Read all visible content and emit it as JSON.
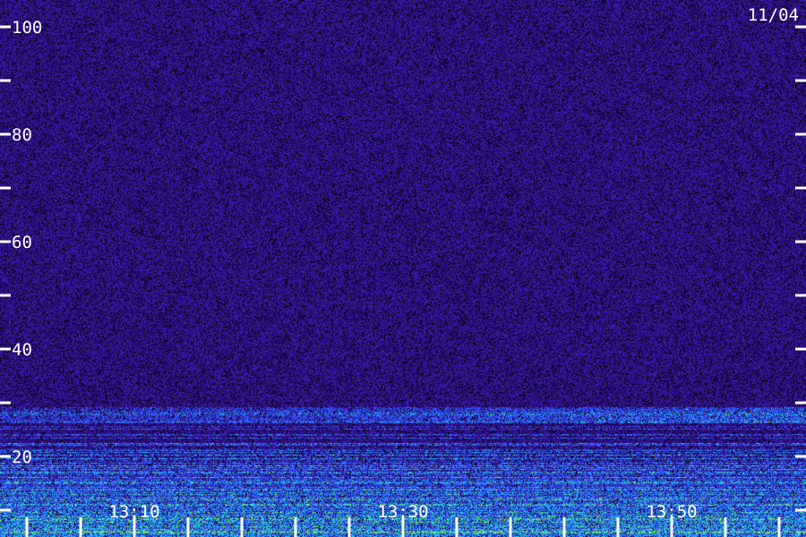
{
  "date_label": "11/04",
  "colors": {
    "background": "#000000",
    "noise_low": "#2a0a6e",
    "noise_mid": "#3a1bb0",
    "band_blue": "#2f5cff",
    "band_cyan": "#22c8e8",
    "band_green": "#8cff3a",
    "ticks": "#ffffff"
  },
  "chart_data": {
    "type": "heatmap",
    "title": "",
    "xlabel": "",
    "ylabel": "",
    "ylim": [
      0,
      100
    ],
    "xlim": [
      "13:00",
      "14:00"
    ],
    "y_ticks": [
      {
        "value": 100,
        "label": "100"
      },
      {
        "value": 90,
        "label": ""
      },
      {
        "value": 80,
        "label": "80"
      },
      {
        "value": 70,
        "label": ""
      },
      {
        "value": 60,
        "label": "60"
      },
      {
        "value": 50,
        "label": ""
      },
      {
        "value": 40,
        "label": "40"
      },
      {
        "value": 30,
        "label": ""
      },
      {
        "value": 20,
        "label": "20"
      },
      {
        "value": 10,
        "label": ""
      }
    ],
    "x_ticks": [
      {
        "value": "13:02",
        "label": ""
      },
      {
        "value": "13:06",
        "label": ""
      },
      {
        "value": "13:10",
        "label": "13:10"
      },
      {
        "value": "13:14",
        "label": ""
      },
      {
        "value": "13:18",
        "label": ""
      },
      {
        "value": "13:22",
        "label": ""
      },
      {
        "value": "13:26",
        "label": ""
      },
      {
        "value": "13:30",
        "label": "13:30"
      },
      {
        "value": "13:34",
        "label": ""
      },
      {
        "value": "13:38",
        "label": ""
      },
      {
        "value": "13:42",
        "label": ""
      },
      {
        "value": "13:46",
        "label": ""
      },
      {
        "value": "13:50",
        "label": "13:50"
      },
      {
        "value": "13:54",
        "label": ""
      },
      {
        "value": "13:58",
        "label": ""
      }
    ],
    "legend": "none",
    "grid": false
  }
}
